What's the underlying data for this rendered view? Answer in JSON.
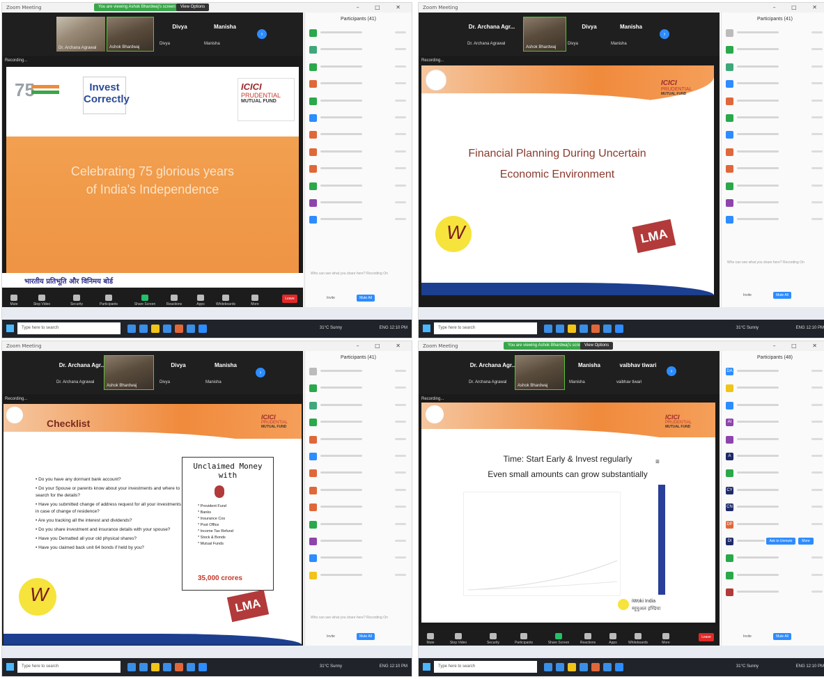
{
  "common": {
    "window_title": "Zoom Meeting",
    "participants_label": "Participants",
    "share_banner": "You are viewing Ashok Bhardwaj's screen",
    "view_options": "View Options",
    "recording": "Recording...",
    "taskbar_search": "Type here to search",
    "weather": "31°C Sunny",
    "tray_time": "12:10 PM",
    "tray_lang": "ENG",
    "participant_note": "Who can see what you share here? Recording On",
    "invite_label": "Invite",
    "mute_all_label": "Mute All",
    "toolbar": [
      "Mute",
      "Stop Video",
      "Security",
      "Participants",
      "Share Screen",
      "Reactions",
      "Apps",
      "Whiteboards",
      "More"
    ],
    "leave": "Leave"
  },
  "q1": {
    "participants_count": "Participants (41)",
    "tile1": "Dr. Archana Agrawal",
    "tile2": "Ashok Bhardwaj",
    "name_a": "Divya",
    "name_b": "Manisha",
    "small_a": "Divya",
    "small_b": "Manisha",
    "logo_invest": "Invest Correctly",
    "logo_75": "75",
    "logo_icici": "ICICI",
    "logo_pru": "PRUDENTIAL",
    "logo_mf": "MUTUAL FUND",
    "headline_1": "Celebrating 75 glorious years",
    "headline_2": "of India's Independence",
    "hindi": "भारतीय प्रतिभूति और विनिमय बोर्ड"
  },
  "q2": {
    "participants_count": "Participants (41)",
    "name_main": "Dr. Archana Agr...",
    "name_a": "Divya",
    "name_b": "Manisha",
    "small_0": "Dr. Archana Agrawal",
    "small_1": "Ashok Bhardwaj",
    "small_a": "Divya",
    "small_b": "Manisha",
    "logo_icici": "ICICI",
    "logo_pru": "PRUDENTIAL",
    "logo_mf": "MUTUAL FUND",
    "title_1": "Financial Planning During Uncertain",
    "title_2": "Economic Environment",
    "lma": "LMA"
  },
  "q3": {
    "participants_count": "Participants (41)",
    "name_main": "Dr. Archana Agr...",
    "name_a": "Divya",
    "name_b": "Manisha",
    "small_0": "Dr. Archana Agrawal",
    "small_1": "Ashok Bhardwaj",
    "small_a": "Divya",
    "small_b": "Manisha",
    "checklist": "Checklist",
    "logo_icici": "ICICI",
    "logo_pru": "PRUDENTIAL",
    "logo_mf": "MUTUAL FUND",
    "items": [
      "Do you have any dormant bank account?",
      "Do your Spouse or parents know about your investments and where to search for the details?",
      "Have you submitted change of address request for all your investments in case of change of residence?",
      "Are you tracking all the interest and dividends?",
      "Do you share investment and insurance details with your spouse?",
      "Have you Dematted all your old physical shares?",
      "Have you claimed back unit 64 bonds if held by you?"
    ],
    "unclaimed_title": "Unclaimed Money with",
    "unclaimed_rows": [
      "Provident Fund",
      "Banks",
      "Insurance Cos",
      "Post Office",
      "Income Tax Refund",
      "Stock & Bonds",
      "Mutual Funds"
    ],
    "crores": "35,000 crores",
    "lma": "LMA"
  },
  "q4": {
    "participants_count": "Participants (48)",
    "name_main": "Dr. Archana Agr...",
    "name_a": "Manisha",
    "name_b": "vaibhav tiwari",
    "small_0": "Dr. Archana Agrawal",
    "small_1": "Ashok Bhardwaj",
    "small_a": "Manisha",
    "small_b": "vaibhav tiwari",
    "logo_icici": "ICICI",
    "logo_pru": "PRUDENTIAL",
    "logo_mf": "MUTUAL FUND",
    "time_title_1": "Time: Start Early & Invest regularly",
    "time_title_2": "Even small amounts can grow substantially",
    "ask_unmute": "Ask to Unmute",
    "more": "More",
    "iwoki": "iWoki India",
    "iwoki_hindi": "म्यूचुअल इण्डिया",
    "ribbon_btn": "Share",
    "avatars": [
      "DA",
      "",
      "",
      "AI",
      "",
      "A",
      "",
      "CY",
      "CN",
      "DP",
      "DI",
      "",
      "",
      "",
      ""
    ]
  },
  "colors": {
    "orange": "#f08a3c",
    "zoom_blue": "#2d8cff",
    "maroon": "#9b2a2a"
  }
}
